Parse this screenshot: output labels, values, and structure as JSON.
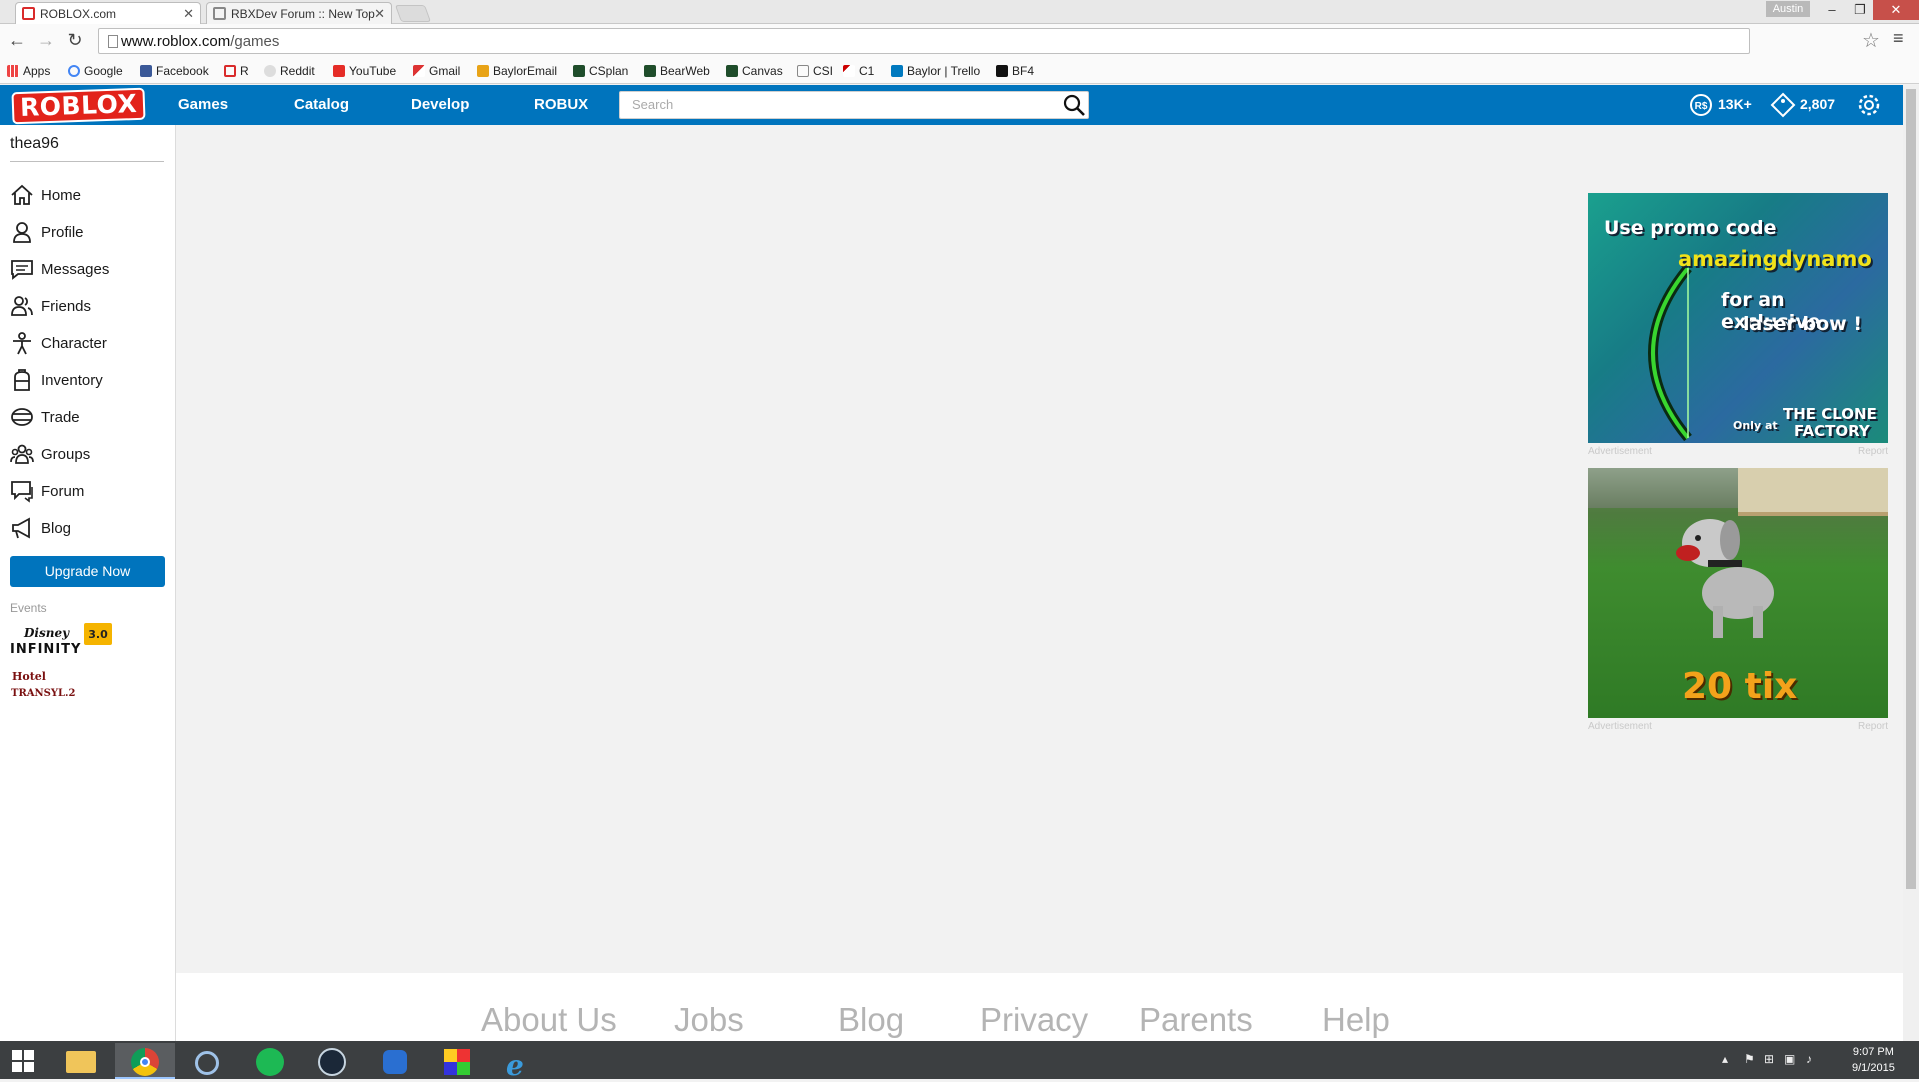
{
  "browser": {
    "tabs": [
      {
        "title": "ROBLOX.com",
        "active": true
      },
      {
        "title": "RBXDev Forum :: New Top",
        "active": false
      }
    ],
    "user": "Austin",
    "url_host": "www.roblox.com",
    "url_path": "/games",
    "bookmarks": [
      "Apps",
      "Google",
      "Facebook",
      "R",
      "Reddit",
      "YouTube",
      "Gmail",
      "BaylorEmail",
      "CSplan",
      "BearWeb",
      "Canvas",
      "CSI",
      "C1",
      "Baylor | Trello",
      "BF4"
    ]
  },
  "header": {
    "logo": "ROBLOX",
    "nav": [
      "Games",
      "Catalog",
      "Develop",
      "ROBUX"
    ],
    "search_placeholder": "Search",
    "robux": "13K+",
    "tickets": "2,807"
  },
  "sidebar": {
    "username": "thea96",
    "items": [
      "Home",
      "Profile",
      "Messages",
      "Friends",
      "Character",
      "Inventory",
      "Trade",
      "Groups",
      "Forum",
      "Blog"
    ],
    "upgrade": "Upgrade Now",
    "events_label": "Events",
    "events": [
      {
        "name": "Disney Infinity",
        "badge": "3.0"
      },
      {
        "name": "Hotel Transylvania 2"
      }
    ]
  },
  "ads": [
    {
      "lines": [
        "Use promo code",
        "amazingdynamo",
        "for an exclusive",
        "laser bow !",
        "Only at",
        "THE CLONE",
        "FACTORY"
      ],
      "footer_left": "Advertisement",
      "footer_right": "Report"
    },
    {
      "price": "20 tix",
      "footer_left": "Advertisement",
      "footer_right": "Report"
    }
  ],
  "footer_links": [
    "About Us",
    "Jobs",
    "Blog",
    "Privacy",
    "Parents",
    "Help"
  ],
  "taskbar": {
    "time": "9:07 PM",
    "date": "9/1/2015"
  },
  "colors": {
    "brand_blue": "#0074bd",
    "logo_red": "#e2231a",
    "promo_yellow": "#f0e21a",
    "tix_orange": "#f3a21b"
  }
}
